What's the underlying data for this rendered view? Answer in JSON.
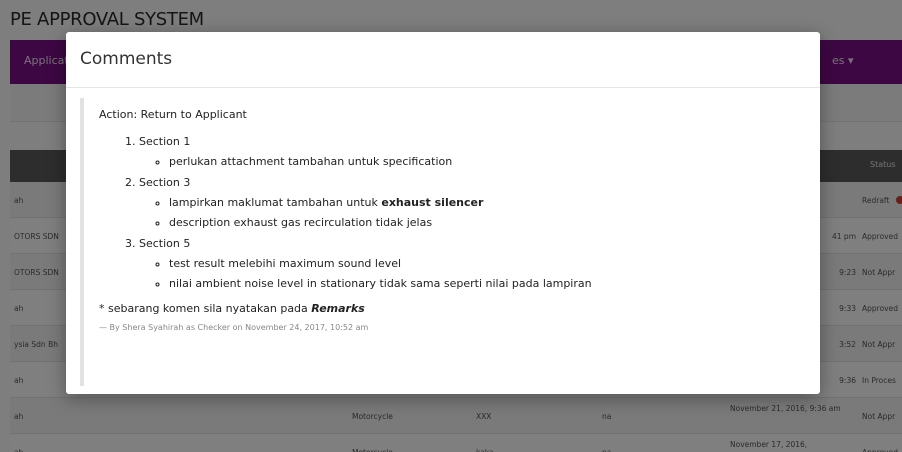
{
  "app": {
    "title": "PE APPROVAL SYSTEM",
    "nav_left": "Applicat",
    "nav_right": "es ▾"
  },
  "table": {
    "status_header": "Status",
    "rows": [
      {
        "name": "ah",
        "type": "",
        "model": "",
        "na": "",
        "date": "",
        "status": "Redraft"
      },
      {
        "name": "OTORS SDN",
        "type": "",
        "model": "",
        "na": "",
        "date": "41 pm",
        "status": "Approved"
      },
      {
        "name": "OTORS SDN",
        "type": "",
        "model": "",
        "na": "",
        "date": "9:23",
        "status": "Not Appr"
      },
      {
        "name": "ah",
        "type": "",
        "model": "",
        "na": "",
        "date": "9:33",
        "status": "Approved"
      },
      {
        "name": "ysia Sdn Bh",
        "type": "",
        "model": "",
        "na": "",
        "date": "3:52",
        "status": "Not Appr"
      },
      {
        "name": "ah",
        "type": "",
        "model": "",
        "na": "",
        "date": "9:36",
        "status": "In Proces"
      },
      {
        "name": "ah",
        "type": "Motorcycle",
        "model": "XXX",
        "na": "na",
        "date": "November 21, 2016, 9:36 am",
        "status": "Not Appr"
      },
      {
        "name": "ah",
        "type": "Motorcycle",
        "model": "kaka",
        "na": "na",
        "date": "November 17, 2016,",
        "status": "Approved"
      }
    ]
  },
  "modal": {
    "title": "Comments",
    "action_label": "Action: Return to Applicant",
    "sections": [
      {
        "title": "Section 1",
        "items": [
          {
            "text": "perlukan attachment tambahan untuk specification",
            "bold": ""
          }
        ]
      },
      {
        "title": "Section 3",
        "items": [
          {
            "text": "lampirkan maklumat tambahan untuk ",
            "bold": "exhaust silencer"
          },
          {
            "text": "description exhaust gas recirculation tidak jelas",
            "bold": ""
          }
        ]
      },
      {
        "title": "Section 5",
        "items": [
          {
            "text": "test result melebihi maximum sound level",
            "bold": ""
          },
          {
            "text": "nilai ambient noise level in stationary tidak sama seperti nilai pada lampiran",
            "bold": ""
          }
        ]
      }
    ],
    "note_text": "* sebarang komen sila nyatakan pada ",
    "note_bold": "Remarks",
    "signature": "— By Shera Syahirah as Checker on November 24, 2017, 10:52 am"
  }
}
